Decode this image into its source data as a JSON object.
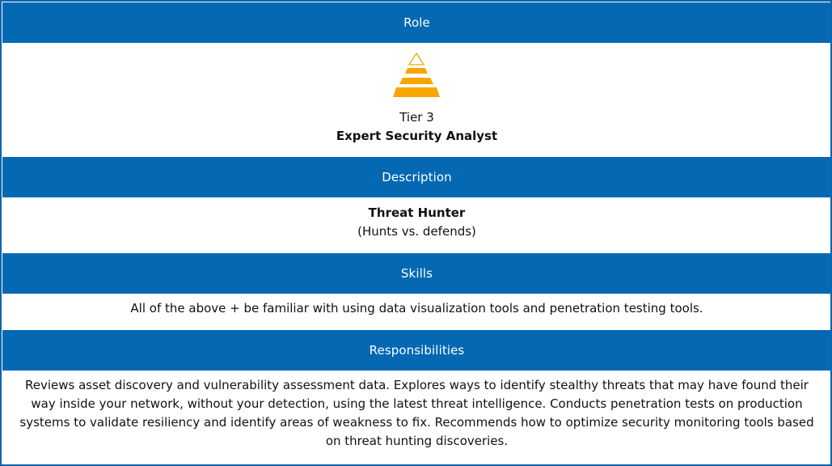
{
  "role": {
    "header": "Role",
    "tier": "Tier 3",
    "title": "Expert Security Analyst",
    "icon": "pyramid-icon",
    "icon_color": "#f7a600"
  },
  "description": {
    "header": "Description",
    "title": "Threat Hunter",
    "subtitle": "(Hunts vs. defends)"
  },
  "skills": {
    "header": "Skills",
    "text": "All of the above + be familiar with using data visualization tools and penetration testing tools."
  },
  "responsibilities": {
    "header": "Responsibilities",
    "text": "Reviews asset discovery and vulnerability assessment data. Explores ways to identify stealthy threats that may have found their way inside your network, without your detection, using the latest threat intelligence. Conducts penetration tests on production systems to validate resiliency and identify areas of weakness to fix. Recommends how to optimize security monitoring tools based on threat hunting discoveries."
  },
  "colors": {
    "header_bg": "#0468b3",
    "border": "#0a63ad",
    "header_text": "#ffffff"
  }
}
